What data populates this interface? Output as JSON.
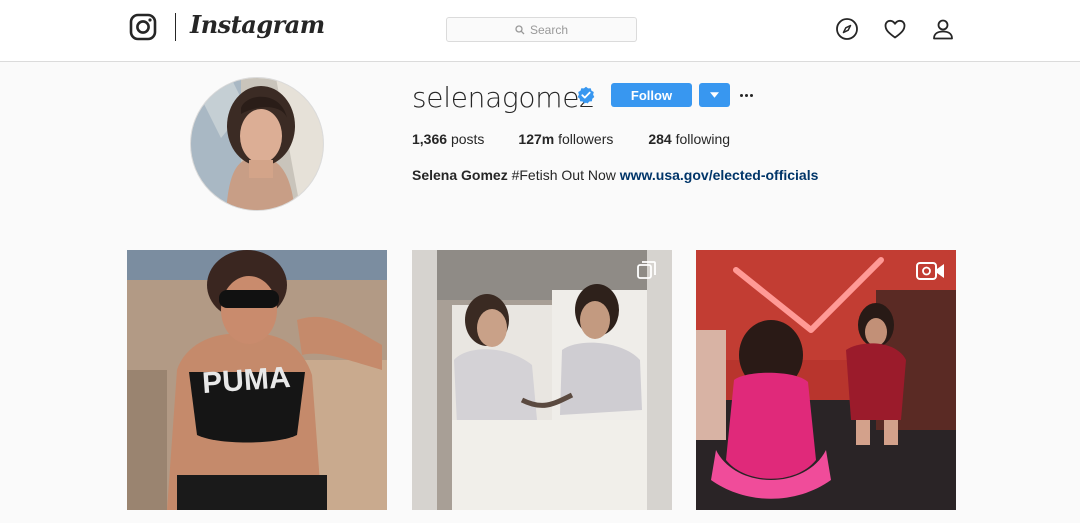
{
  "nav": {
    "logo_text": "Instagram",
    "search_placeholder": "Search",
    "icons": [
      "instagram-glyph-icon",
      "search-icon",
      "explore-compass-icon",
      "activity-heart-icon",
      "profile-person-icon"
    ]
  },
  "profile": {
    "username": "selenagomez",
    "verified": true,
    "follow_label": "Follow",
    "stats": {
      "posts_count": "1,366",
      "posts_label": "posts",
      "followers_count": "127m",
      "followers_label": "followers",
      "following_count": "284",
      "following_label": "following"
    },
    "bio": {
      "name": "Selena Gomez",
      "text": "#Fetish Out Now",
      "link": "www.usa.gov/elected-officials"
    }
  },
  "posts": [
    {
      "type": "photo",
      "badge": null
    },
    {
      "type": "carousel",
      "badge": "carousel-icon"
    },
    {
      "type": "video",
      "badge": "video-camera-icon"
    }
  ],
  "colors": {
    "accent_blue": "#3897f0",
    "link_blue": "#003569",
    "border": "#dbdbdb",
    "background": "#fafafa"
  }
}
